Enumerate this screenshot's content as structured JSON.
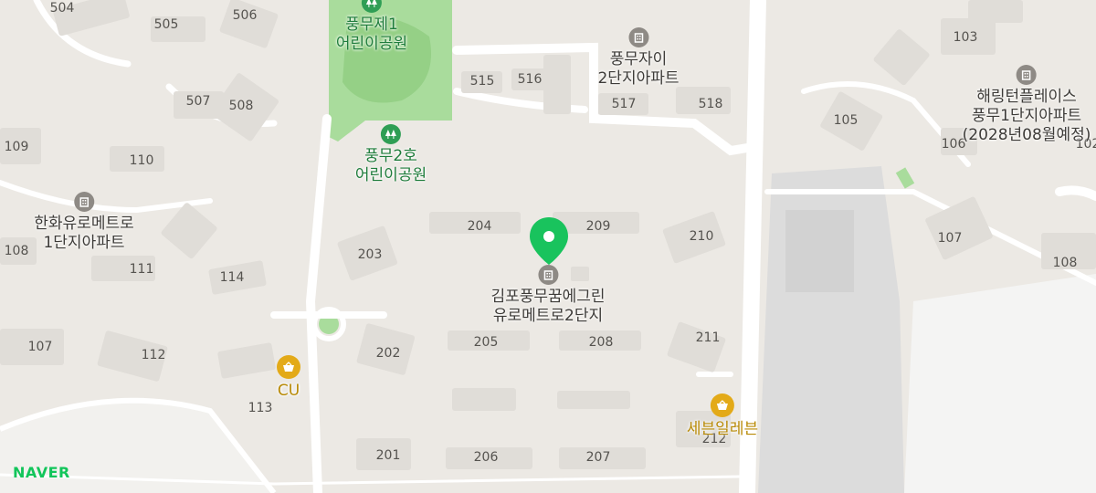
{
  "colors": {
    "background": "#ece9e4",
    "road": "#ffffff",
    "building": "#e0ddd8",
    "park": "#a9dc9c",
    "marker": "#19c35d",
    "park_text": "#1f7d3c",
    "store_text": "#b88a06",
    "brand": "#12c55a"
  },
  "logo": {
    "text": "NAVER"
  },
  "selected_place": {
    "line1": "김포풍무꿈에그린",
    "line2": "유로메트로2단지",
    "icon": "apartment-icon"
  },
  "apartments": [
    {
      "line1": "풍무자이",
      "line2": "2단지아파트",
      "icon": "apartment-icon"
    },
    {
      "line1": "해링턴플레이스",
      "line2": "풍무1단지아파트",
      "line3": "(2028년08월예정)",
      "icon": "apartment-icon"
    },
    {
      "line1": "한화유로메트로",
      "line2": "1단지아파트",
      "icon": "apartment-icon"
    }
  ],
  "parks": [
    {
      "line1": "풍무제1",
      "line2": "어린이공원",
      "icon": "tree-icon"
    },
    {
      "line1": "풍무2호",
      "line2": "어린이공원",
      "icon": "tree-icon"
    }
  ],
  "stores": [
    {
      "name": "CU",
      "icon": "shopping-basket-icon"
    },
    {
      "name": "세븐일레븐",
      "icon": "shopping-basket-icon"
    }
  ],
  "building_labels": [
    "504",
    "505",
    "506",
    "507",
    "508",
    "515",
    "516",
    "517",
    "518",
    "109",
    "110",
    "108",
    "111",
    "114",
    "203",
    "204",
    "209",
    "210",
    "107",
    "112",
    "113",
    "202",
    "205",
    "208",
    "211",
    "201",
    "206",
    "207",
    "212",
    "103",
    "105",
    "106",
    "107",
    "108",
    "102"
  ]
}
